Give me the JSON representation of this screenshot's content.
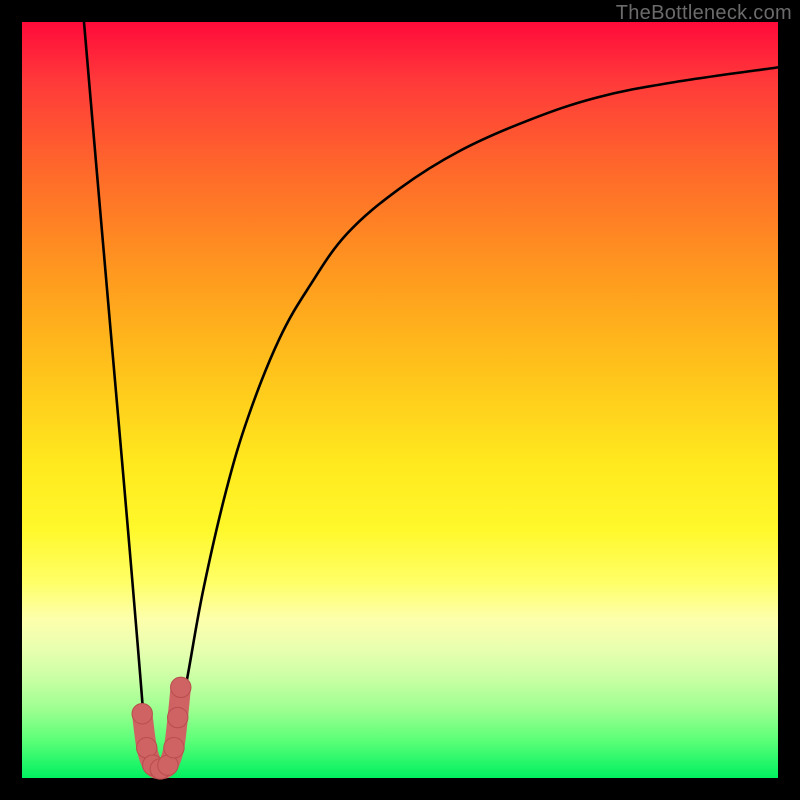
{
  "watermark": "TheBottleneck.com",
  "colors": {
    "frame": "#000000",
    "curve": "#000000",
    "marker_fill": "#cf6363",
    "marker_stroke": "#b84d4d"
  },
  "chart_data": {
    "type": "line",
    "title": "",
    "xlabel": "",
    "ylabel": "",
    "xlim": [
      0,
      100
    ],
    "ylim": [
      0,
      100
    ],
    "grid": false,
    "legend": false,
    "series": [
      {
        "name": "left-branch",
        "x": [
          8.2,
          10.0,
          12.0,
          13.4,
          14.6,
          15.6,
          16.4
        ],
        "y": [
          100,
          79,
          56,
          40,
          26,
          14,
          4
        ]
      },
      {
        "name": "right-branch",
        "x": [
          20.2,
          22.0,
          24.0,
          27.0,
          30.0,
          34.0,
          38.0,
          43.0,
          50.0,
          58.0,
          67.0,
          76.0,
          86.0,
          100.0
        ],
        "y": [
          4,
          14,
          25,
          38,
          48,
          58,
          65,
          72,
          78,
          83,
          87,
          90,
          92,
          94
        ]
      },
      {
        "name": "valley-floor",
        "x": [
          16.4,
          17.0,
          18.0,
          19.0,
          20.2
        ],
        "y": [
          4,
          1.5,
          1,
          1.5,
          4
        ]
      }
    ],
    "markers": {
      "name": "highlight-J",
      "points": [
        {
          "x": 15.9,
          "y": 8.5
        },
        {
          "x": 16.5,
          "y": 4.0
        },
        {
          "x": 17.3,
          "y": 1.7
        },
        {
          "x": 18.3,
          "y": 1.2
        },
        {
          "x": 19.3,
          "y": 1.7
        },
        {
          "x": 20.1,
          "y": 4.0
        },
        {
          "x": 20.6,
          "y": 8.0
        },
        {
          "x": 21.0,
          "y": 12.0
        }
      ],
      "radius_pct": 1.35
    }
  }
}
